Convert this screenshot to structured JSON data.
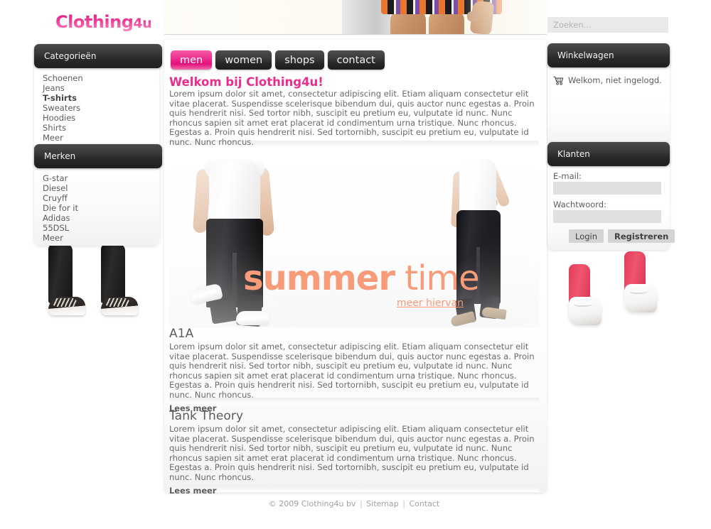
{
  "site": {
    "logo_main": "Clothing",
    "logo_suffix": "4u",
    "logo_color": "#ec2c8c"
  },
  "search": {
    "placeholder": "Zoeken...",
    "value": ""
  },
  "nav": {
    "tabs": [
      {
        "label": "men",
        "active": true
      },
      {
        "label": "women",
        "active": false
      },
      {
        "label": "shops",
        "active": false
      },
      {
        "label": "contact",
        "active": false
      }
    ]
  },
  "sidebar_left": {
    "categories": {
      "title": "Categorieën",
      "items": [
        {
          "label": "Schoenen",
          "active": false
        },
        {
          "label": "Jeans",
          "active": false
        },
        {
          "label": "T-shirts",
          "active": true
        },
        {
          "label": "Sweaters",
          "active": false
        },
        {
          "label": "Hoodies",
          "active": false
        },
        {
          "label": "Shirts",
          "active": false
        },
        {
          "label": "Meer",
          "active": false
        }
      ]
    },
    "brands": {
      "title": "Merken",
      "items": [
        {
          "label": "G-star",
          "active": false
        },
        {
          "label": "Diesel",
          "active": false
        },
        {
          "label": "Cruyff",
          "active": false
        },
        {
          "label": "Die for it",
          "active": false
        },
        {
          "label": "Adidas",
          "active": false
        },
        {
          "label": "55DSL",
          "active": false
        },
        {
          "label": "Meer",
          "active": false
        }
      ]
    }
  },
  "main": {
    "welcome_title": "Welkom bij Clothing4u!",
    "intro_text": "Lorem ipsum dolor sit amet, consectetur adipiscing elit. Etiam aliquam consectetur elit vitae placerat. Suspendisse scelerisque bibendum dui, quis auctor nunc  egestas a. Proin quis hendrerit nisi. Sed tortor nibh, suscipit eu pretium eu,  vulputate id nunc. Nunc rhoncus sapien sit amet erat placerat id condimentum urna tristique. Nunc rhoncus. Egestas a. Proin quis hendrerit nisi. Sed tortornibh, suscipit eu pretium eu, vulputate id nunc. Nunc rhoncus.",
    "hero": {
      "title_bold": "summer",
      "title_thin": "time",
      "subtitle": "meer hiervan",
      "accent_color": "#f79b79"
    },
    "articles": [
      {
        "title": "A1A",
        "body": "Lorem ipsum dolor sit amet, consectetur adipiscing elit. Etiam aliquam consectetur elit vitae placerat. Suspendisse scelerisque bibendum dui, quis auctor nunc  egestas a. Proin quis hendrerit nisi. Sed tortor nibh, suscipit eu pretium eu,  vulputate id nunc. Nunc rhoncus sapien sit amet erat placerat id condimentum urna tristique. Nunc rhoncus. Egestas a. Proin quis hendrerit nisi. Sed tortornibh, suscipit eu pretium eu, vulputate id nunc. Nunc rhoncus.",
        "more_label": "Lees meer"
      },
      {
        "title": "Tank Theory",
        "body": "Lorem ipsum dolor sit amet, consectetur adipiscing elit. Etiam aliquam consectetur elit vitae placerat. Suspendisse scelerisque bibendum dui, quis auctor nunc  egestas a. Proin quis hendrerit nisi. Sed tortor nibh, suscipit eu pretium eu,  vulputate id nunc. Nunc rhoncus sapien sit amet erat placerat id condimentum urna tristique. Nunc rhoncus. Egestas a. Proin quis hendrerit nisi. Sed tortornibh, suscipit eu pretium eu, vulputate id nunc. Nunc rhoncus.",
        "more_label": "Lees meer"
      }
    ]
  },
  "sidebar_right": {
    "cart": {
      "title": "Winkelwagen",
      "status": "Welkom, niet ingelogd.",
      "icon": "shopping-cart-icon"
    },
    "customers": {
      "title": "Klanten",
      "email_label": "E-mail:",
      "email_value": "",
      "password_label": "Wachtwoord:",
      "password_value": "",
      "login_label": "Login",
      "register_label": "Registreren"
    }
  },
  "footer": {
    "copyright": "© 2009 Clothing4u bv",
    "sitemap_label": "Sitemap",
    "contact_label": "Contact",
    "separator": "|"
  }
}
